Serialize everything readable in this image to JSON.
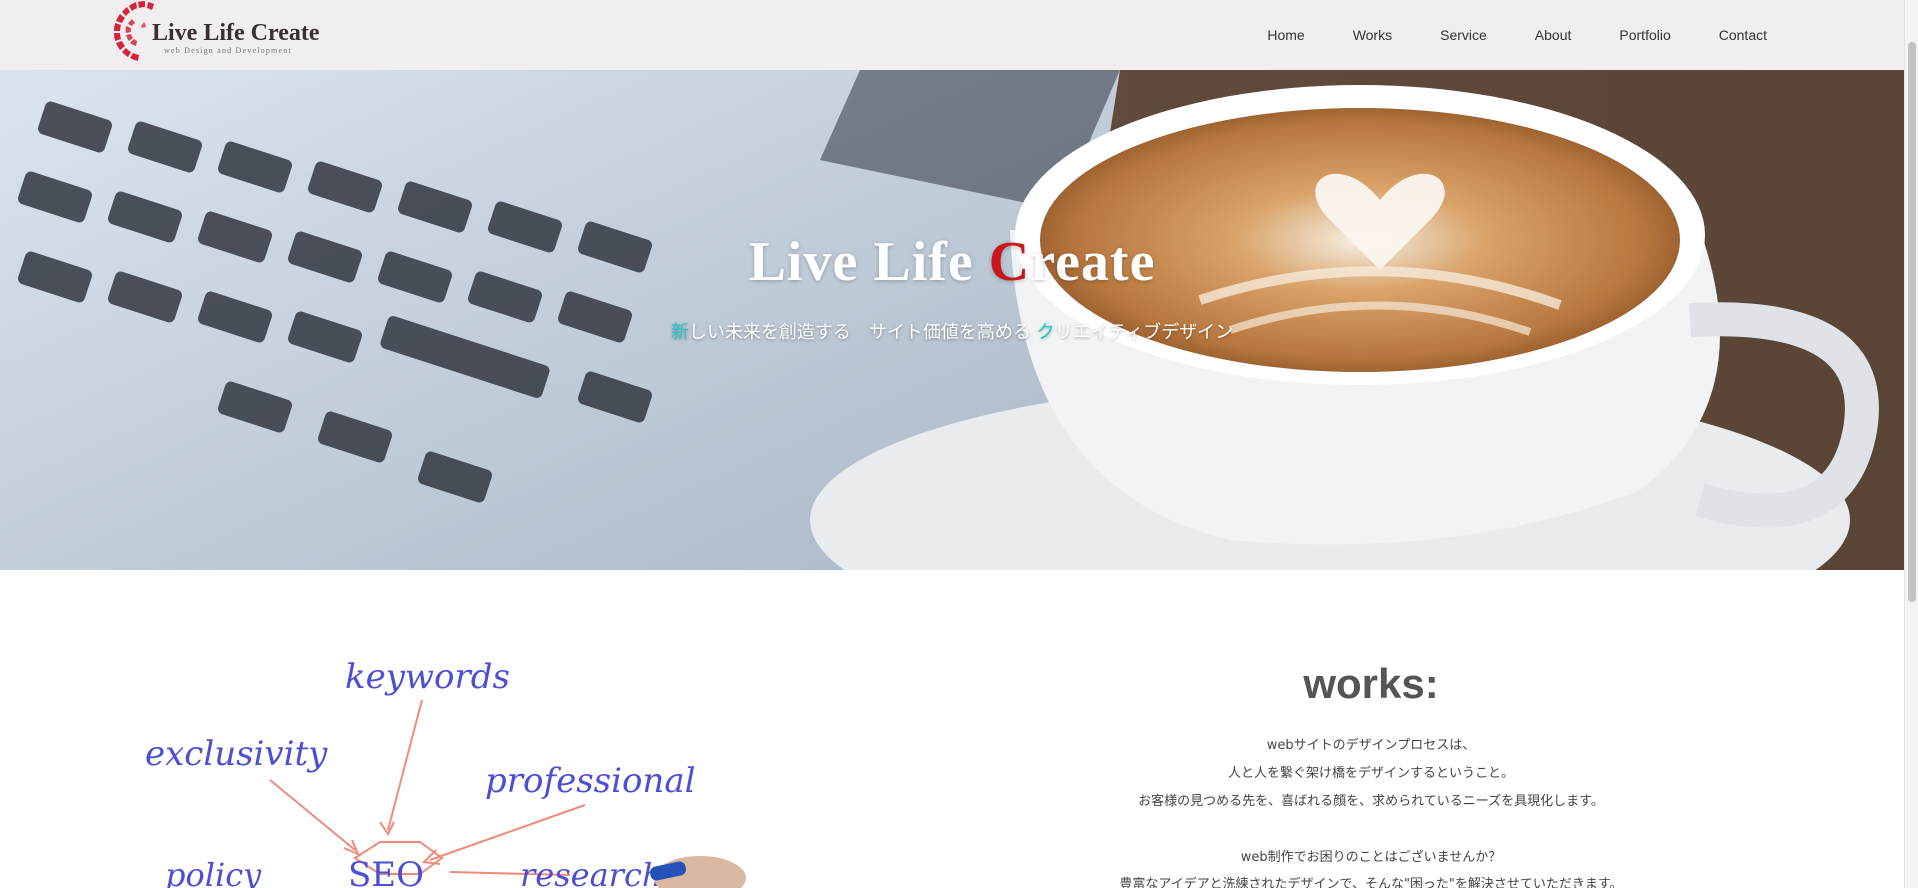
{
  "header": {
    "logo_title": "Live Life Create",
    "logo_subtitle": "web Design and Development",
    "nav": [
      "Home",
      "Works",
      "Service",
      "About",
      "Portfolio",
      "Contact"
    ]
  },
  "hero": {
    "title_part1": "Live Life ",
    "title_accent": "C",
    "title_part2": "reate",
    "subtitle_teal1": "新",
    "subtitle_part1": "しい未来を創造する　サイト価値を高める",
    "subtitle_teal2": "ク",
    "subtitle_part2": "リエイティブデザイン"
  },
  "illustration": {
    "words": [
      "keywords",
      "exclusivity",
      "professional",
      "policy",
      "SEO",
      "research"
    ]
  },
  "works": {
    "title": "works:",
    "lines": [
      "webサイトのデザインプロセスは、",
      "人と人を繋ぐ架け橋をデザインするということ。",
      "お客様の見つめる先を、喜ばれる顔を、求められているニーズを具現化します。",
      "web制作でお困りのことはございませんか？",
      "豊富なアイデアと洗練されたデザインで、そんな\"困った\"を解決させていただきます。"
    ]
  },
  "colors": {
    "header_bg": "#f0eeee",
    "accent_red": "#c8161d",
    "accent_teal": "#1ec9c5",
    "illustration_ink": "#4a4fd6",
    "illustration_arrows": "#f08a7a"
  }
}
